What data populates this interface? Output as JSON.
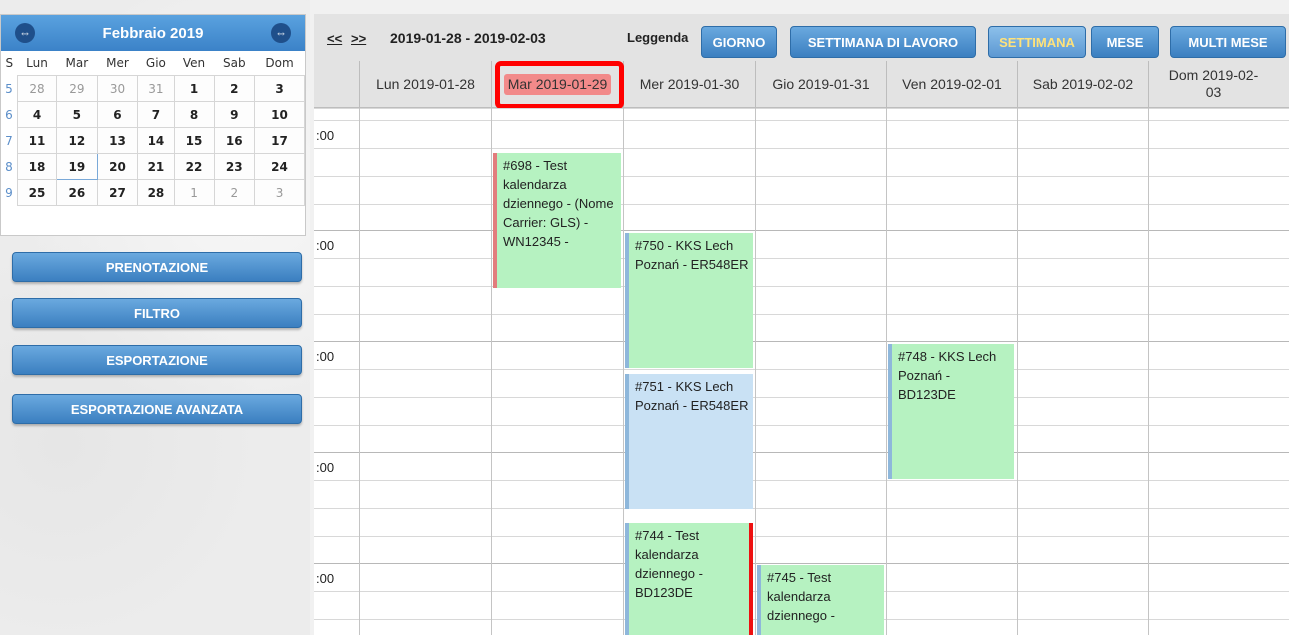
{
  "mini_calendar": {
    "month_title": "Febbraio 2019",
    "prev_icon": "arrows-icon",
    "next_icon": "arrows-icon",
    "week_col_header": "S",
    "weekday_headers": [
      "Lun",
      "Mar",
      "Mer",
      "Gio",
      "Ven",
      "Sab",
      "Dom"
    ],
    "weeks": [
      {
        "week": "5",
        "days": [
          "28",
          "29",
          "30",
          "31",
          "1",
          "2",
          "3"
        ]
      },
      {
        "week": "6",
        "days": [
          "4",
          "5",
          "6",
          "7",
          "8",
          "9",
          "10"
        ]
      },
      {
        "week": "7",
        "days": [
          "11",
          "12",
          "13",
          "14",
          "15",
          "16",
          "17"
        ]
      },
      {
        "week": "8",
        "days": [
          "18",
          "19",
          "20",
          "21",
          "22",
          "23",
          "24"
        ]
      },
      {
        "week": "9",
        "days": [
          "25",
          "26",
          "27",
          "28",
          "1",
          "2",
          "3"
        ]
      }
    ]
  },
  "sidebar_buttons": {
    "prenotazione": "PRENOTAZIONE",
    "filtro": "FILTRO",
    "esportazione": "ESPORTAZIONE",
    "esportazione_avanzata": "ESPORTAZIONE AVANZATA"
  },
  "toolbar": {
    "prev_label": "<<",
    "next_label": ">>",
    "date_range": "2019-01-28 - 2019-02-03",
    "legend_label": "Leggenda",
    "views": {
      "giorno": "GIORNO",
      "settimana_lavoro": "SETTIMANA DI LAVORO",
      "settimana": "SETTIMANA",
      "mese": "MESE",
      "multi_mese": "MULTI MESE"
    }
  },
  "days": {
    "mon": "Lun 2019-01-28",
    "tue": "Mar 2019-01-29",
    "wed": "Mer 2019-01-30",
    "thu": "Gio 2019-01-31",
    "fri": "Ven 2019-02-01",
    "sat": "Sab 2019-02-02",
    "sun": "Dom 2019-02-03"
  },
  "time_labels": {
    "r1": ":00",
    "r2": ":00",
    "r3": ":00",
    "r4": ":00",
    "r5": ":00"
  },
  "events": {
    "e698": "#698 - Test kalendarza dziennego - (Nome Carrier: GLS) - WN12345 -",
    "e750": "#750 - KKS Lech Poznań - ER548ER",
    "e751": "#751 - KKS Lech Poznań - ER548ER",
    "e748": "#748 - KKS Lech Poznań - BD123DE",
    "e744": "#744 - Test kalendarza dziennego - BD123DE",
    "e745": "#745 - Test kalendarza dziennego -"
  }
}
